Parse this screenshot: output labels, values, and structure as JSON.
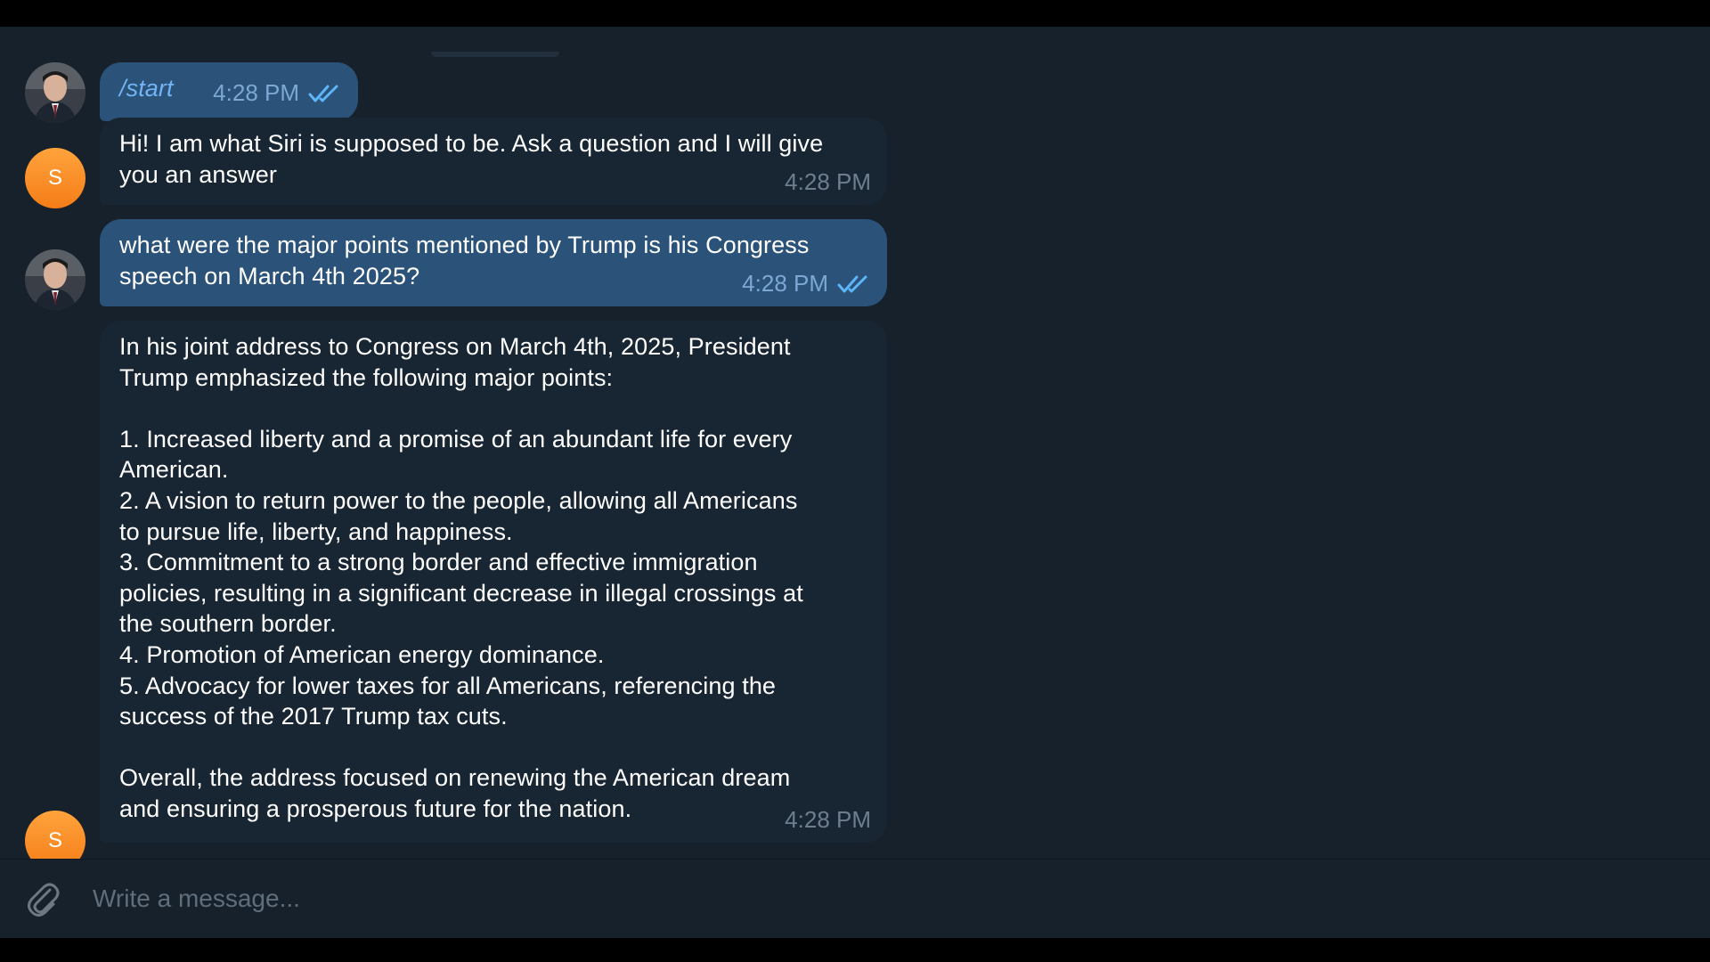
{
  "chat": {
    "messages": [
      {
        "sender": "user",
        "text": "/start",
        "time": "4:28 PM",
        "status": "read"
      },
      {
        "sender": "bot",
        "avatar_letter": "S",
        "text": "Hi! I am what Siri is supposed to be. Ask a question and I will give\nyou an answer",
        "time": "4:28 PM"
      },
      {
        "sender": "user",
        "text": "what were the major points mentioned by Trump is his Congress\nspeech on March 4th 2025?",
        "time": "4:28 PM",
        "status": "read"
      },
      {
        "sender": "bot",
        "avatar_letter": "S",
        "text": "In his joint address to Congress on March 4th, 2025, President\nTrump emphasized the following major points:\n\n1. Increased liberty and a promise of an abundant life for every\nAmerican.\n2. A vision to return power to the people, allowing all Americans\nto pursue life, liberty, and happiness.\n3. Commitment to a strong border and effective immigration\npolicies, resulting in a significant decrease in illegal crossings at\nthe southern border.\n4. Promotion of American energy dominance.\n5. Advocacy for lower taxes for all Americans, referencing the\nsuccess of the 2017 Trump tax cuts.\n\nOverall, the address focused on renewing the American dream\nand ensuring a prosperous future for the nation.",
        "time": "4:28 PM"
      }
    ]
  },
  "composer": {
    "placeholder": "Write a message...",
    "value": ""
  },
  "icons": {
    "attach": "paperclip-icon",
    "read_status": "double-check-icon"
  },
  "colors": {
    "chat_background": "#17212b",
    "outgoing_bubble": "#2b5278",
    "incoming_bubble": "#182533",
    "bot_avatar": "#f7921e",
    "check_mark": "#5eb5f7"
  }
}
